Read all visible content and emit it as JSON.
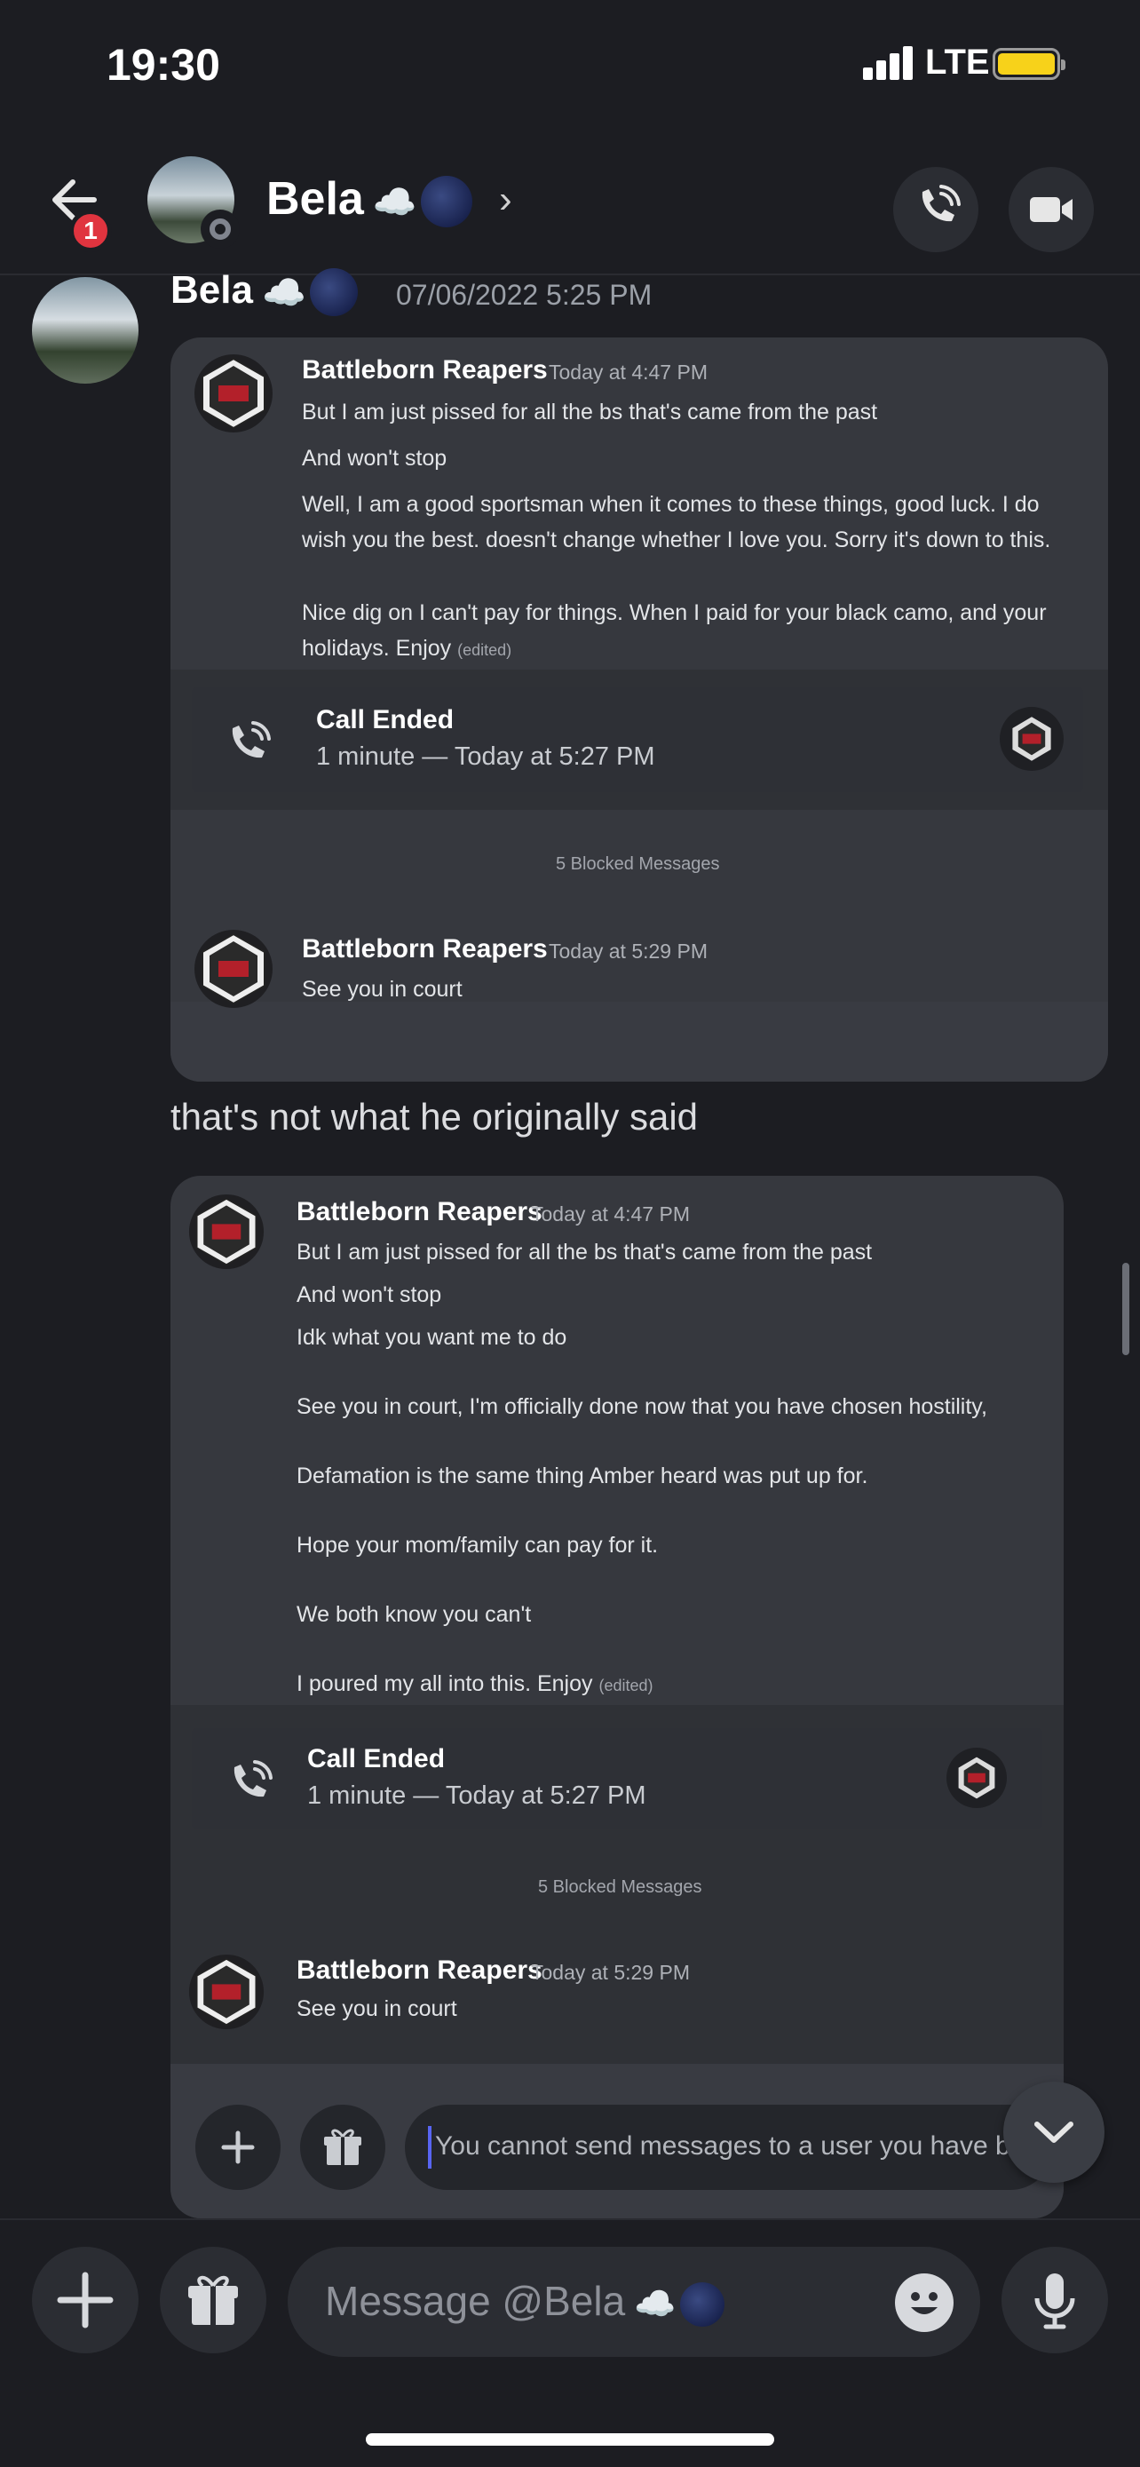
{
  "status_bar": {
    "time": "19:30",
    "network": "LTE"
  },
  "header": {
    "badge_count": "1",
    "contact_name": "Bela",
    "contact_cloud": "☁️",
    "chevron": "›"
  },
  "message": {
    "author": "Bela",
    "timestamp": "07/06/2022 5:25 PM",
    "followup_text": "that's not what he originally said"
  },
  "screenshot1": {
    "first": {
      "author": "Battleborn Reapers",
      "time": "Today at 4:47 PM",
      "lines": [
        "But I am just pissed for all the bs that's came from the past",
        "And won't stop",
        "Well, I am a good sportsman when it comes to these things, good luck. I do",
        "wish you the best. doesn't change whether I love you. Sorry it's down to this.",
        "Nice dig on I can't pay for things. When I paid for your black camo, and your",
        "holidays. Enjoy"
      ],
      "edited": "(edited)"
    },
    "call": {
      "title": "Call Ended",
      "sub": "1 minute — Today at 5:27 PM"
    },
    "blocked": "5 Blocked Messages",
    "second": {
      "author": "Battleborn Reapers",
      "time": "Today at 5:29 PM",
      "text": "See you in court"
    }
  },
  "screenshot2": {
    "first": {
      "author": "Battleborn Reapers",
      "time": "Today at 4:47 PM",
      "lines": [
        "But I am just pissed for all the bs that's came from the past",
        "And won't stop",
        "Idk what you want me to do",
        "See you in court, I'm officially done now that you have chosen hostility,",
        "Defamation is the same thing Amber heard was put up for.",
        "Hope your mom/family can pay for it.",
        "We both know you can't",
        "I poured my all into this. Enjoy"
      ],
      "edited": "(edited)"
    },
    "call": {
      "title": "Call Ended",
      "sub": "1 minute — Today at 5:27 PM"
    },
    "blocked": "5 Blocked Messages",
    "second": {
      "author": "Battleborn Reapers",
      "time": "Today at 5:29 PM",
      "text": "See you in court"
    },
    "composer_placeholder": "You cannot send messages to a user you have b..."
  },
  "composer": {
    "placeholder": "Message @Bela",
    "cloud": "☁️"
  },
  "icons": [
    "back-arrow-icon",
    "phone-call-icon",
    "video-camera-icon",
    "plus-icon",
    "gift-icon",
    "emoji-icon",
    "microphone-icon",
    "chevron-down-icon"
  ],
  "colors": {
    "background": "#1c1d22",
    "badge": "#e0343f",
    "battery": "#f7d21a",
    "caret": "#5865f2"
  }
}
